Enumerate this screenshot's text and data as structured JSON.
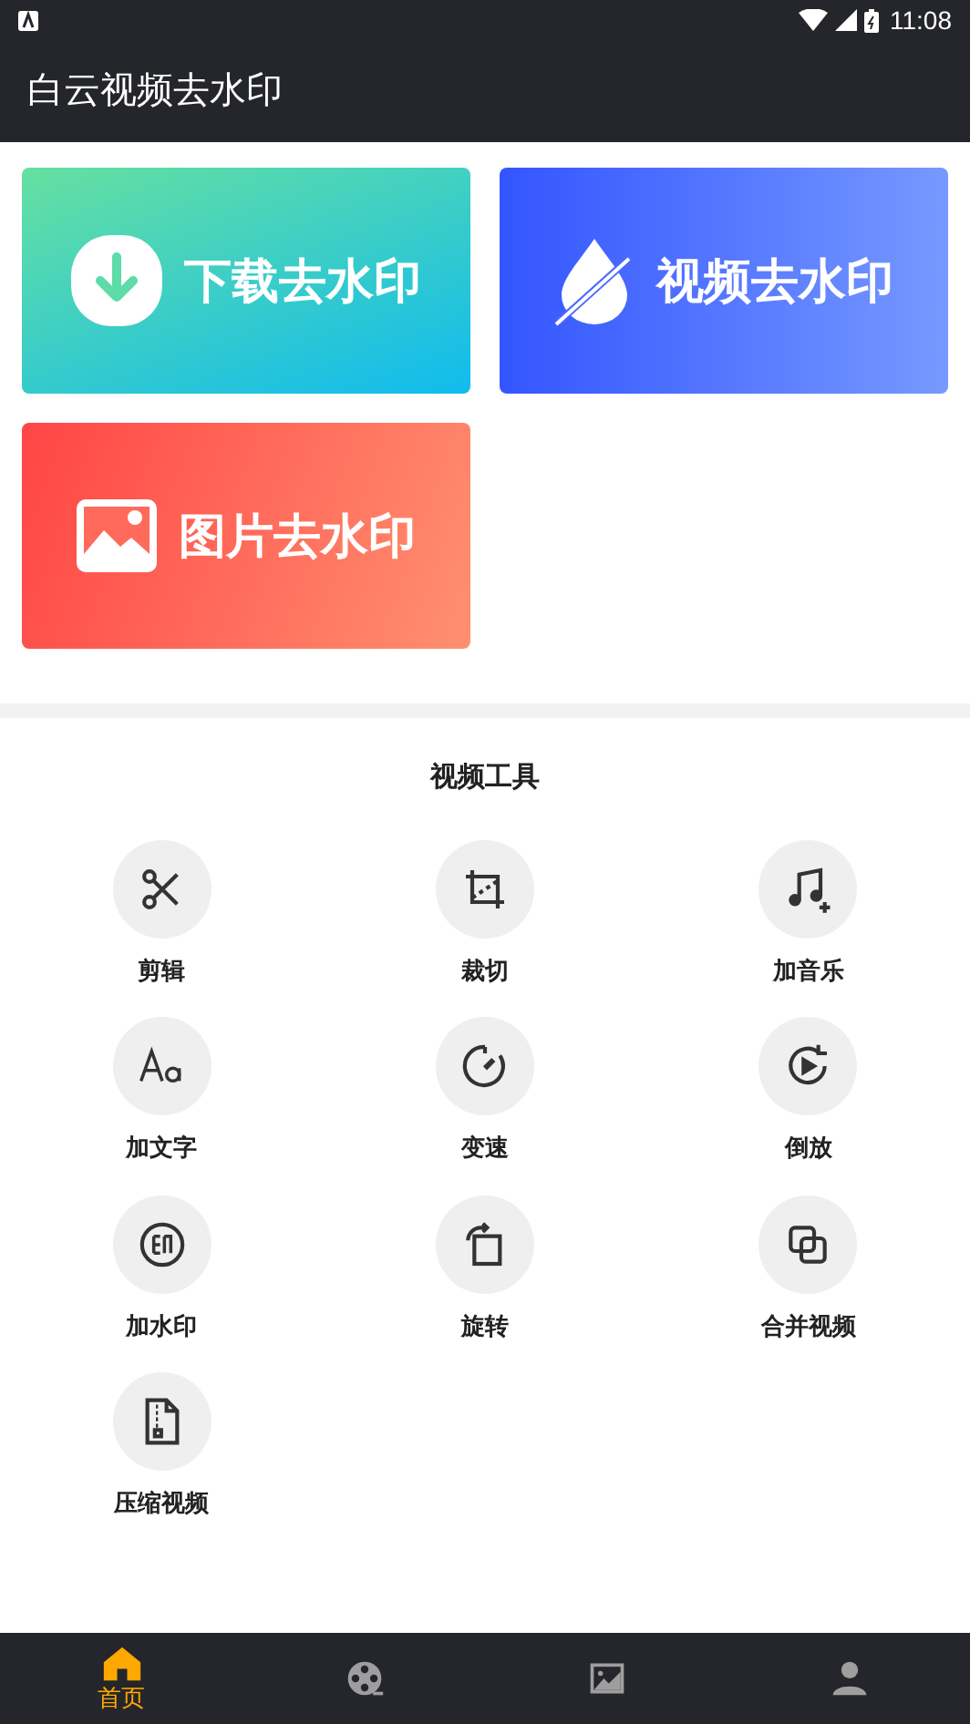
{
  "status_bar": {
    "time": "11:08"
  },
  "app_bar": {
    "title": "白云视频去水印"
  },
  "cards": [
    {
      "kind": "download",
      "label": "下载去水印"
    },
    {
      "kind": "video",
      "label": "视频去水印"
    },
    {
      "kind": "image",
      "label": "图片去水印"
    }
  ],
  "tools": {
    "title": "视频工具",
    "items": [
      {
        "kind": "cut",
        "label": "剪辑"
      },
      {
        "kind": "crop",
        "label": "裁切"
      },
      {
        "kind": "music",
        "label": "加音乐"
      },
      {
        "kind": "text",
        "label": "加文字"
      },
      {
        "kind": "speed",
        "label": "变速"
      },
      {
        "kind": "reverse",
        "label": "倒放"
      },
      {
        "kind": "watermark",
        "label": "加水印"
      },
      {
        "kind": "rotate",
        "label": "旋转"
      },
      {
        "kind": "merge",
        "label": "合并视频"
      },
      {
        "kind": "compress",
        "label": "压缩视频"
      }
    ]
  },
  "bottom_nav": [
    {
      "kind": "home",
      "label": "首页",
      "selected": true
    },
    {
      "kind": "film",
      "selected": false
    },
    {
      "kind": "image",
      "selected": false
    },
    {
      "kind": "person",
      "selected": false
    }
  ]
}
